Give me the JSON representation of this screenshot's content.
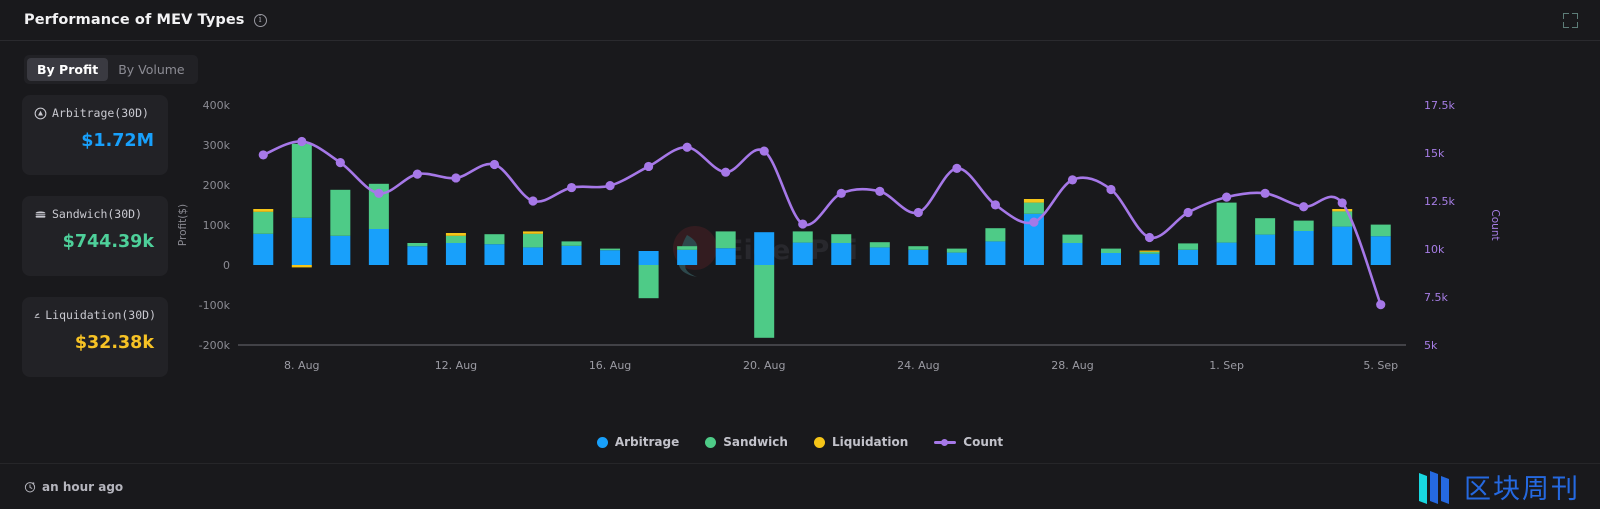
{
  "header": {
    "title": "Performance of MEV Types",
    "info_icon": "info-icon",
    "fullscreen_icon": "fullscreen-icon"
  },
  "tabs": [
    {
      "label": "By Profit",
      "active": true
    },
    {
      "label": "By Volume",
      "active": false
    }
  ],
  "cards": [
    {
      "icon": "arbitrage-icon",
      "label": "Arbitrage(30D)",
      "value": "$1.72M",
      "color": "#18a0fb"
    },
    {
      "icon": "sandwich-icon",
      "label": "Sandwich(30D)",
      "value": "$744.39k",
      "color": "#4ed09a"
    },
    {
      "icon": "liquidation-icon",
      "label": "Liquidation(30D)",
      "value": "$32.38k",
      "color": "#f7c325"
    }
  ],
  "legend": [
    {
      "label": "Arbitrage",
      "color": "#18a0fb",
      "marker": "dot"
    },
    {
      "label": "Sandwich",
      "color": "#4ecb87",
      "marker": "dot"
    },
    {
      "label": "Liquidation",
      "color": "#f5c518",
      "marker": "dot"
    },
    {
      "label": "Count",
      "color": "#a678e8",
      "marker": "line"
    }
  ],
  "watermark": {
    "text": "EigenPhi"
  },
  "footer": {
    "clock_icon": "clock-icon",
    "updated": "an hour ago",
    "brand": "区块周刊"
  },
  "chart_data": {
    "type": "bar",
    "title": "Performance of MEV Types",
    "xlabel": "",
    "ylabel": "Profit($)",
    "y2label": "Count",
    "ylim": [
      -200000,
      400000
    ],
    "y2lim": [
      5000,
      17500
    ],
    "grid": false,
    "legend_position": "bottom",
    "y_ticks": [
      "400k",
      "300k",
      "200k",
      "100k",
      "0",
      "-100k",
      "-200k"
    ],
    "y_tick_values": [
      400000,
      300000,
      200000,
      100000,
      0,
      -100000,
      -200000
    ],
    "y2_ticks": [
      "17.5k",
      "15k",
      "12.5k",
      "10k",
      "7.5k",
      "5k"
    ],
    "y2_tick_values": [
      17500,
      15000,
      12500,
      10000,
      7500,
      5000
    ],
    "x_ticks": [
      "8. Aug",
      "12. Aug",
      "16. Aug",
      "20. Aug",
      "24. Aug",
      "28. Aug",
      "1. Sep",
      "5. Sep"
    ],
    "x_tick_index": [
      1,
      5,
      9,
      13,
      17,
      21,
      25,
      29
    ],
    "x": [
      "7. Aug",
      "8. Aug",
      "9. Aug",
      "10. Aug",
      "11. Aug",
      "12. Aug",
      "13. Aug",
      "14. Aug",
      "15. Aug",
      "16. Aug",
      "17. Aug",
      "18. Aug",
      "19. Aug",
      "20. Aug",
      "21. Aug",
      "22. Aug",
      "23. Aug",
      "24. Aug",
      "25. Aug",
      "26. Aug",
      "27. Aug",
      "28. Aug",
      "29. Aug",
      "30. Aug",
      "31. Aug",
      "1. Sep",
      "2. Sep",
      "3. Sep",
      "4. Sep",
      "5. Sep"
    ],
    "series": [
      {
        "name": "Arbitrage",
        "color": "#18a0fb",
        "axis": "left",
        "stack": "profit",
        "values": [
          78000,
          118000,
          73000,
          90000,
          47000,
          55000,
          52000,
          44000,
          48000,
          37000,
          35000,
          38000,
          42000,
          82000,
          56000,
          55000,
          44000,
          38000,
          31000,
          59000,
          128000,
          55000,
          30000,
          28000,
          38000,
          56000,
          76000,
          85000,
          96000,
          72000
        ]
      },
      {
        "name": "Sandwich",
        "color": "#4ecb87",
        "axis": "left",
        "stack": "profit",
        "values": [
          55000,
          185000,
          115000,
          113000,
          8000,
          18000,
          25000,
          34000,
          11000,
          4000,
          -83000,
          9000,
          42000,
          -182000,
          28000,
          22000,
          13000,
          9000,
          10000,
          33000,
          28000,
          21000,
          11000,
          5000,
          16000,
          100000,
          41000,
          26000,
          38000,
          29000
        ]
      },
      {
        "name": "Liquidation",
        "color": "#f5c518",
        "axis": "left",
        "stack": "profit",
        "values": [
          7000,
          -6000,
          0,
          0,
          0,
          7000,
          0,
          6000,
          0,
          0,
          0,
          0,
          0,
          0,
          0,
          0,
          0,
          0,
          0,
          0,
          9000,
          0,
          0,
          3000,
          0,
          0,
          0,
          0,
          6000,
          0
        ]
      },
      {
        "name": "Count",
        "color": "#a678e8",
        "axis": "right",
        "type": "line",
        "values": [
          14900,
          15600,
          14500,
          12900,
          13900,
          13700,
          14400,
          12500,
          13200,
          13300,
          14300,
          15300,
          14000,
          15100,
          11300,
          12900,
          13000,
          11900,
          14200,
          12300,
          11400,
          13600,
          13100,
          10600,
          11900,
          12700,
          12900,
          12200,
          12400,
          7100
        ]
      }
    ]
  }
}
